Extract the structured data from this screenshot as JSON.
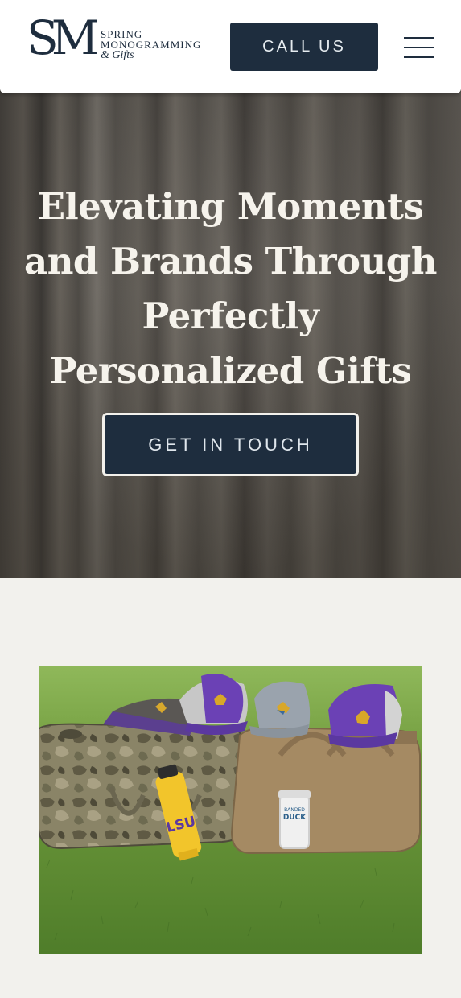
{
  "header": {
    "logo_mark": "SM",
    "logo_line1": "SPRING",
    "logo_line2": "MONOGRAMMING",
    "logo_line3": "& Gifts",
    "call_label": "CALL US"
  },
  "hero": {
    "title": "Elevating Moments and Brands Through Perfectly Personalized Gifts",
    "cta_label": "GET IN TOUCH"
  },
  "photo": {
    "bottle_text": "LSU",
    "tumbler_text_1": "BANDED",
    "tumbler_text_2": "DUCK"
  },
  "colors": {
    "navy": "#1e2d3e",
    "page_bg": "#f2f1ed",
    "hero_text": "#f6f3ec"
  }
}
